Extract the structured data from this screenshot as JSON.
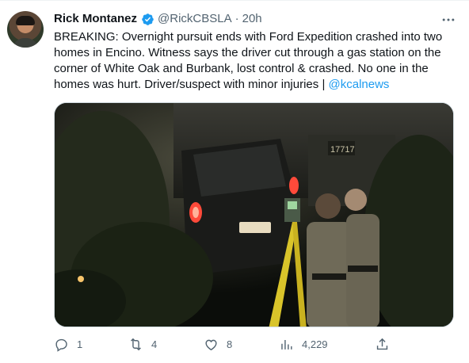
{
  "tweet": {
    "author_name": "Rick Montanez",
    "handle": "@RickCBSLA",
    "separator": "·",
    "time": "20h",
    "text_main": "BREAKING: Overnight pursuit ends with Ford Expedition crashed into two homes in Encino. Witness says the driver cut through a gas station on the corner of White Oak and Burbank, lost control & crashed. No one in the homes was hurt. Driver/suspect with minor injuries | ",
    "text_link": "@kcalnews",
    "house_number": "17717"
  },
  "actions": {
    "replies": "1",
    "retweets": "4",
    "likes": "8",
    "views": "4,229"
  },
  "icons": {
    "verified": "verified-badge-icon",
    "more": "more-options-icon",
    "reply": "reply-icon",
    "retweet": "retweet-icon",
    "like": "heart-icon",
    "views": "views-icon",
    "share": "share-icon"
  },
  "colors": {
    "link": "#1d9bf0",
    "text": "#0f1419",
    "muted": "#536471"
  }
}
